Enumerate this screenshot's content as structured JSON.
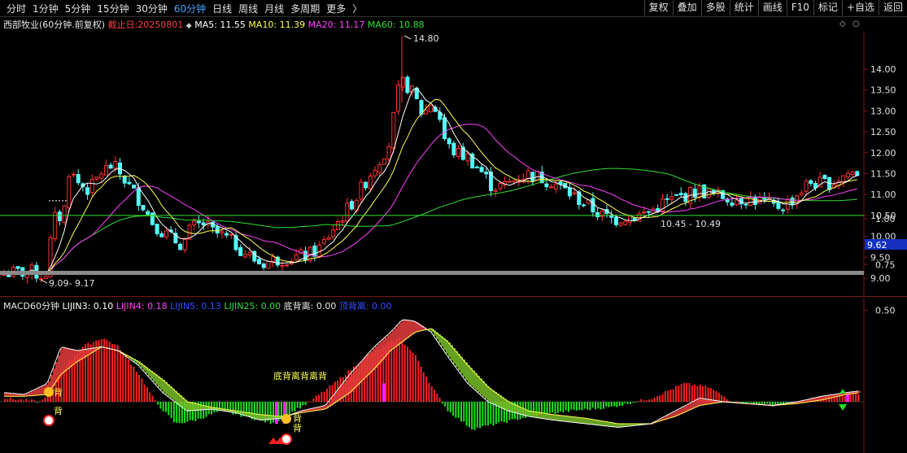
{
  "toolbar": {
    "tabs": [
      {
        "label": "分时"
      },
      {
        "label": "1分钟"
      },
      {
        "label": "5分钟"
      },
      {
        "label": "15分钟"
      },
      {
        "label": "30分钟"
      },
      {
        "label": "60分钟",
        "active": true
      },
      {
        "label": "日线"
      },
      {
        "label": "周线"
      },
      {
        "label": "月线"
      },
      {
        "label": "多周期"
      },
      {
        "label": "更多"
      }
    ],
    "more_arrow": "〉",
    "right": [
      "复权",
      "叠加",
      "多股",
      "统计",
      "画线",
      "F10",
      "标记",
      "+自选",
      "返回"
    ]
  },
  "main_info": {
    "title": "西部牧业(60分钟.前复权)",
    "end_date": "截止日:20250801",
    "ma5": "MA5: 11.55",
    "ma10": "MA10: 11.39",
    "ma20": "MA20: 11.17",
    "ma60": "MA60: 10.88"
  },
  "price_axis": {
    "ticks": [
      "14.00",
      "13.50",
      "13.00",
      "12.50",
      "12.00",
      "11.50",
      "11.00",
      "10.50",
      "10.00",
      "9.50",
      "9.00"
    ],
    "current_price": "9.62"
  },
  "annotations": {
    "high": "14.80",
    "low": "9.17",
    "low_overlap": "9.09",
    "range": "10.45 - 10.49"
  },
  "macd_info": {
    "title": "MACD60分钟",
    "lijin3": "LIJIN3: 0.10",
    "lijin4": "LIJIN4: 0.18",
    "lijin5": "LIJIN5: 0.13",
    "lijin25": "LIJIN25: 0.00",
    "bottom_div": "底背离: 0.00",
    "top_div": "顶背离: 0.00"
  },
  "macd_axis": {
    "ticks": [
      "1.00",
      "0.75",
      "0.50"
    ]
  },
  "macd_labels": {
    "label_a": "背",
    "label_b": "背",
    "label_c": "背",
    "label_d": "背",
    "label_e": "底背离背离背"
  },
  "colors": {
    "up": "#ff3030",
    "down": "#54ffff",
    "ma5": "#ffffff",
    "ma10": "#ffff50",
    "ma20": "#ff40ff",
    "ma60": "#30e030",
    "sep": "#7a1515"
  }
}
